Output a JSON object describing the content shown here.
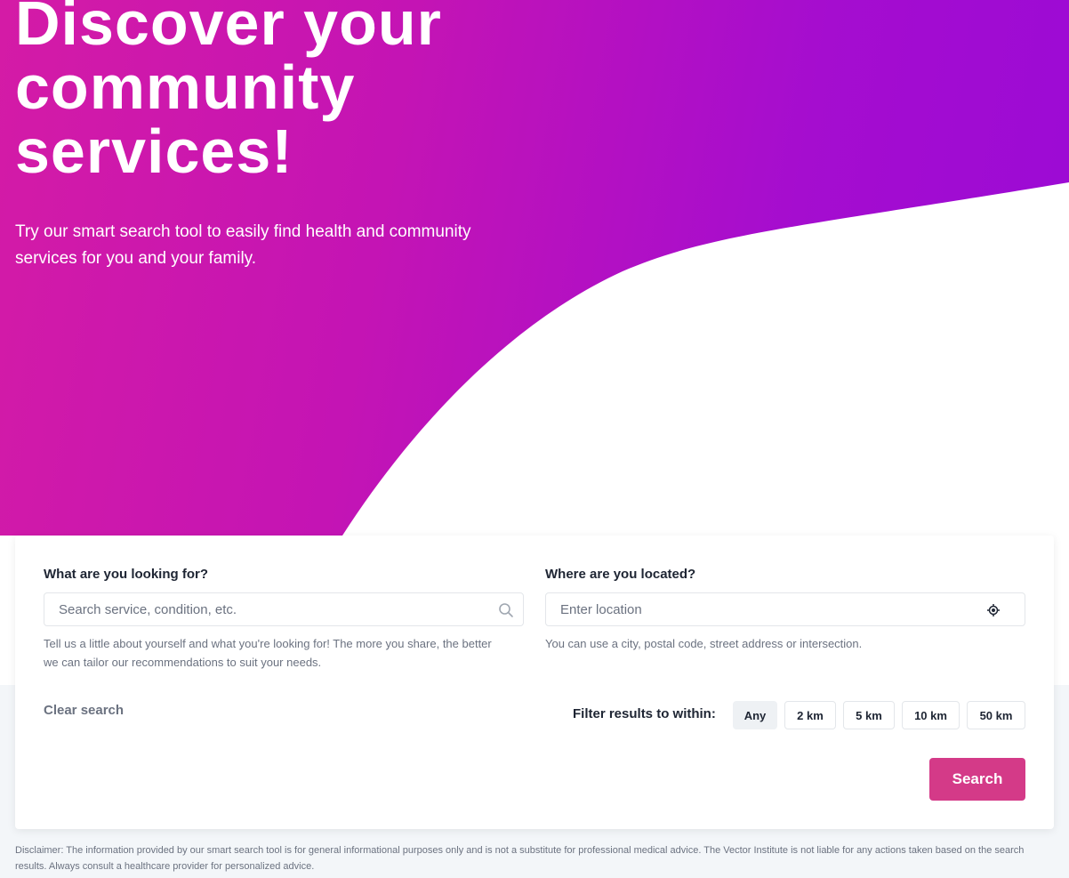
{
  "hero": {
    "title": "Discover your community services!",
    "subtitle": "Try our smart search tool to easily find health and community services for you and your family."
  },
  "search_form": {
    "what": {
      "label": "What are you looking for?",
      "placeholder": "Search service, condition, etc.",
      "value": "",
      "helper": "Tell us a little about yourself and what you're looking for! The more you share, the better we can tailor our recommendations to suit your needs.",
      "icon": "search-icon"
    },
    "where": {
      "label": "Where are you located?",
      "placeholder": "Enter location",
      "value": "",
      "helper": "You can use a city, postal code, street address or intersection.",
      "icon": "locate-icon"
    },
    "clear_label": "Clear search",
    "filter_label": "Filter results to within:",
    "distance_options": [
      "Any",
      "2 km",
      "5 km",
      "10 km",
      "50 km"
    ],
    "selected_distance": "Any",
    "search_label": "Search"
  },
  "disclaimer": "Disclaimer: The information provided by our smart search tool is for general informational purposes only and is not a substitute for professional medical advice. The Vector Institute is not liable for any actions taken based on the search results. Always consult a healthcare provider for personalized advice.",
  "colors": {
    "hero_gradient_start": "#d41ba6",
    "hero_gradient_end": "#9a0ad6",
    "primary_button": "#d43a88",
    "page_background": "#f3f6f9"
  }
}
